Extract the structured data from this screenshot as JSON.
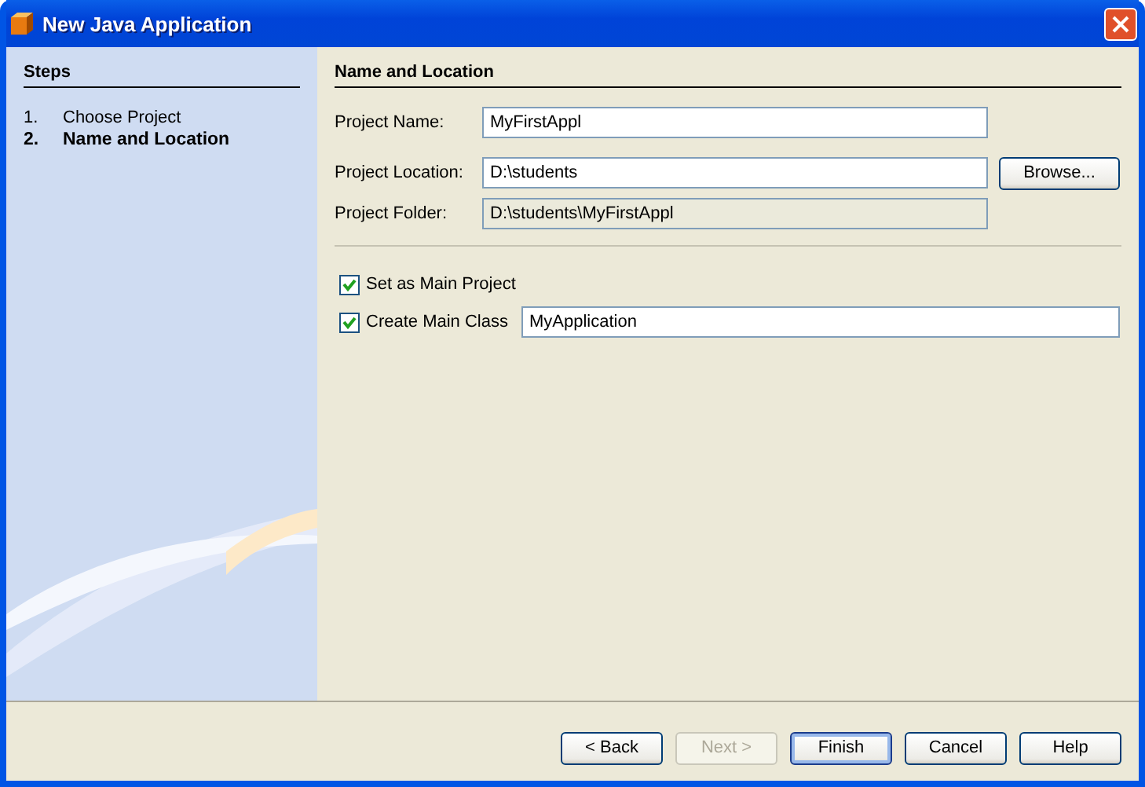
{
  "window": {
    "title": "New Java Application"
  },
  "steps": {
    "title": "Steps",
    "items": [
      {
        "number": "1.",
        "label": "Choose Project",
        "selected": false
      },
      {
        "number": "2.",
        "label": "Name and Location",
        "selected": true
      }
    ]
  },
  "panel": {
    "title": "Name and Location",
    "fields": [
      {
        "label": "Project Name:",
        "value": "MyFirstAppl",
        "disabled": false
      },
      {
        "label": "Project Location:",
        "value": "D:\\students",
        "disabled": false,
        "button": "Browse..."
      },
      {
        "label": "Project Folder:",
        "value": "D:\\students\\MyFirstAppl",
        "disabled": true
      }
    ],
    "options": [
      {
        "label": "Set as Main Project",
        "checked": true
      },
      {
        "label": "Create Main Class",
        "checked": true,
        "value": "MyApplication"
      }
    ]
  },
  "buttons": [
    {
      "label": "< Back",
      "disabled": false,
      "default": false
    },
    {
      "label": "Next >",
      "disabled": true,
      "default": false
    },
    {
      "label": "Finish",
      "disabled": false,
      "default": true
    },
    {
      "label": "Cancel",
      "disabled": false,
      "default": false
    },
    {
      "label": "Help",
      "disabled": false,
      "default": false
    }
  ]
}
